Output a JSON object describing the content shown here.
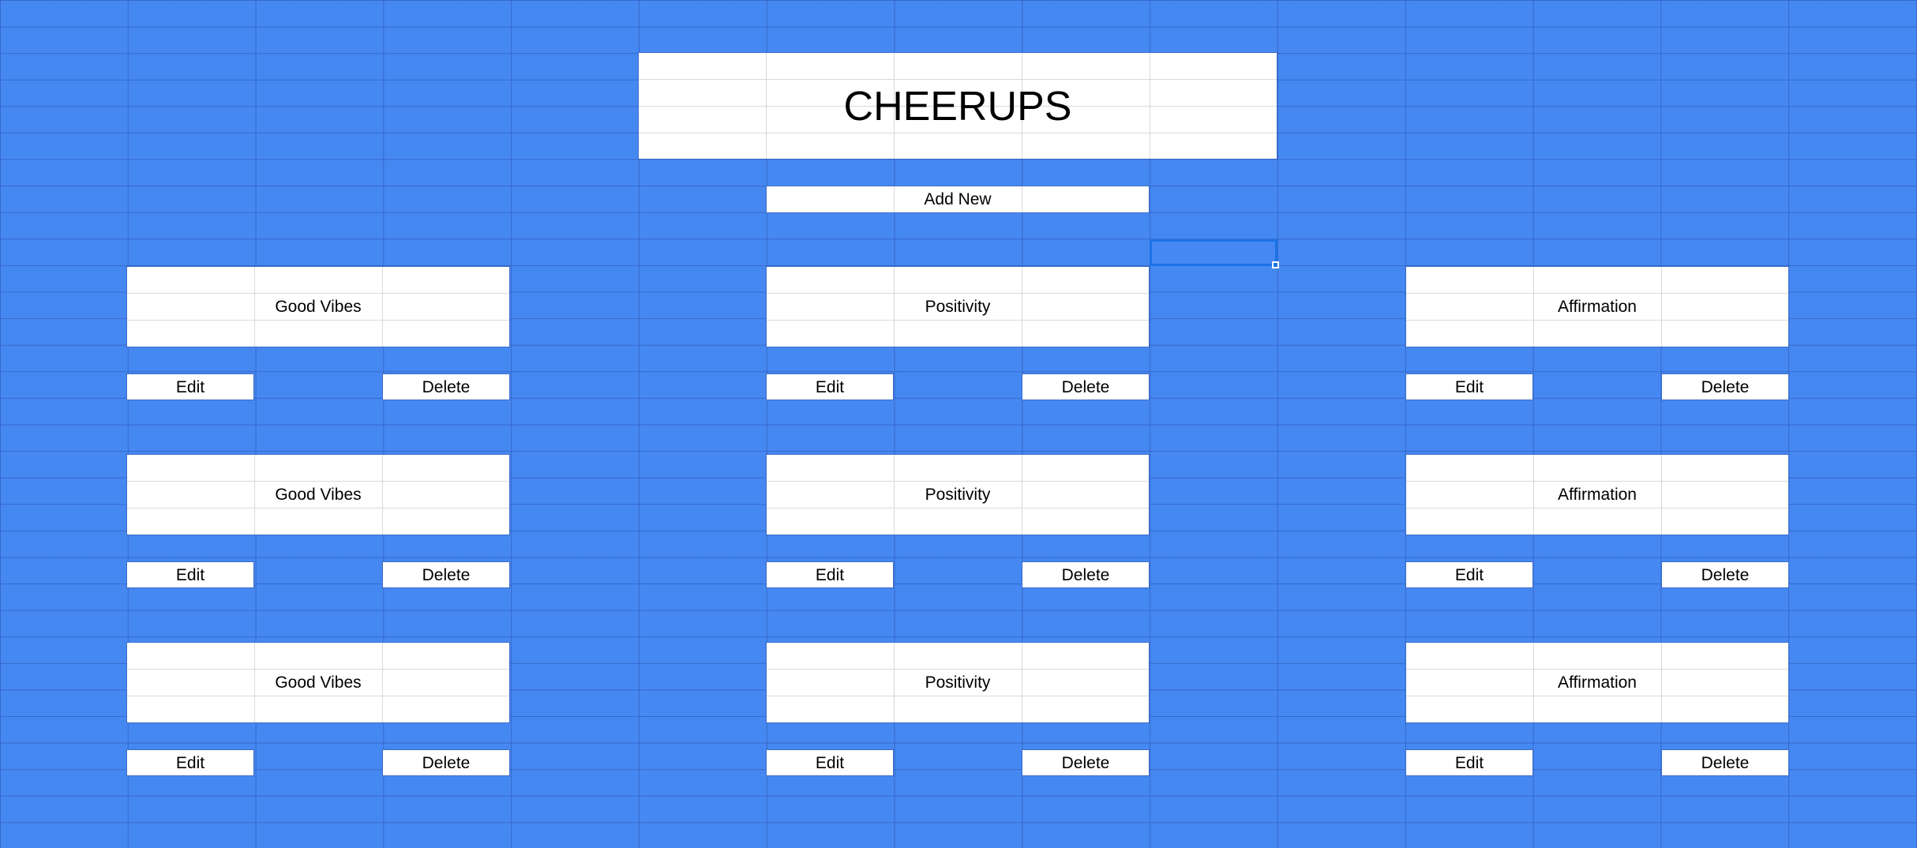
{
  "header": {
    "title": "CHEERUPS",
    "add_new_label": "Add New"
  },
  "columns": [
    {
      "cards": [
        {
          "title": "Good Vibes",
          "edit_label": "Edit",
          "delete_label": "Delete"
        },
        {
          "title": "Good Vibes",
          "edit_label": "Edit",
          "delete_label": "Delete"
        },
        {
          "title": "Good Vibes",
          "edit_label": "Edit",
          "delete_label": "Delete"
        }
      ]
    },
    {
      "cards": [
        {
          "title": "Positivity",
          "edit_label": "Edit",
          "delete_label": "Delete"
        },
        {
          "title": "Positivity",
          "edit_label": "Edit",
          "delete_label": "Delete"
        },
        {
          "title": "Positivity",
          "edit_label": "Edit",
          "delete_label": "Delete"
        }
      ]
    },
    {
      "cards": [
        {
          "title": "Affirmation",
          "edit_label": "Edit",
          "delete_label": "Delete"
        },
        {
          "title": "Affirmation",
          "edit_label": "Edit",
          "delete_label": "Delete"
        },
        {
          "title": "Affirmation",
          "edit_label": "Edit",
          "delete_label": "Delete"
        }
      ]
    }
  ],
  "colors": {
    "background": "#4688f1",
    "selection": "#1a73e8",
    "card": "#ffffff"
  }
}
